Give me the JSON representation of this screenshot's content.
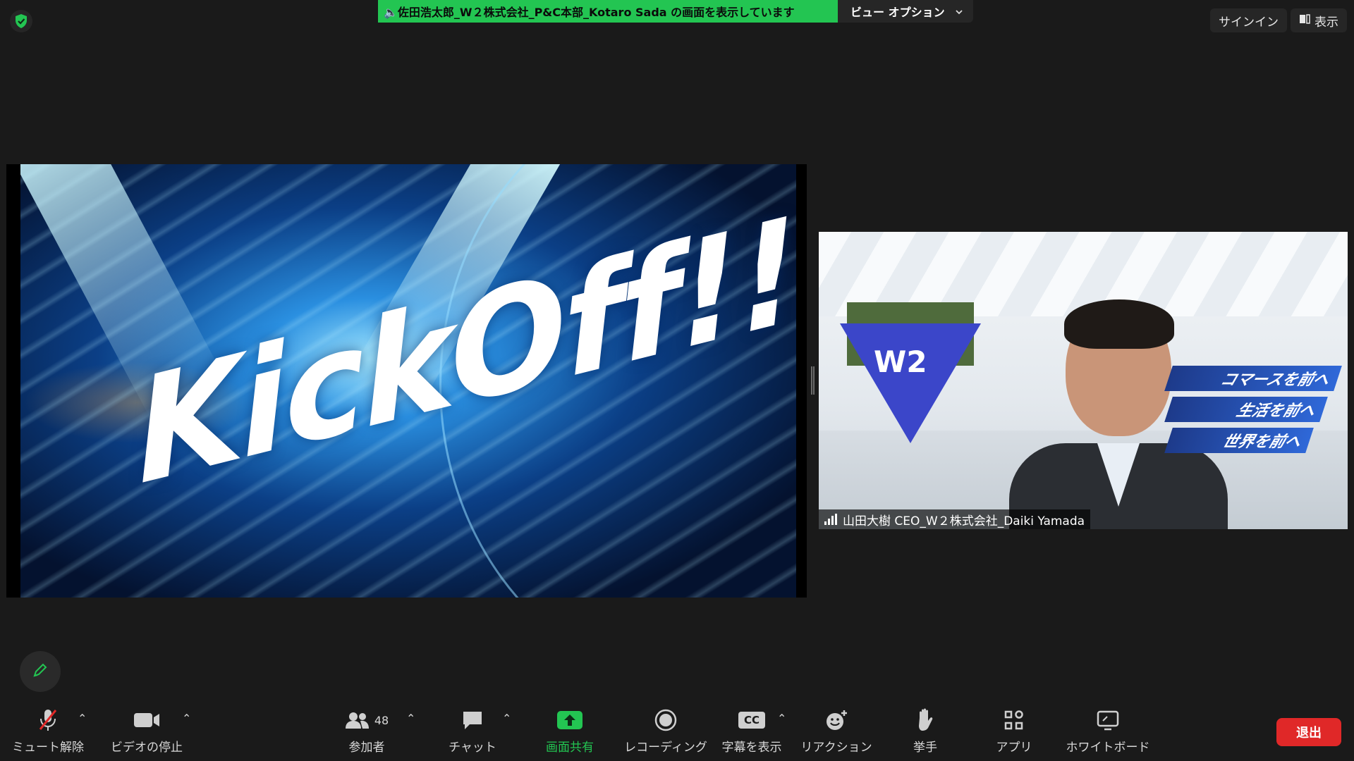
{
  "security": {
    "icon": "shield-check-icon",
    "color": "#23c552"
  },
  "share_banner": {
    "text": "🔈佐田浩太郎_W２株式会社_P&C本部_Kotaro Sada の画面を表示しています",
    "color": "#23c552"
  },
  "view_options": {
    "label": "ビュー オプション"
  },
  "top_right": {
    "signin": "サインイン",
    "display": "表示"
  },
  "shared_screen": {
    "title_text": "KickOff!!"
  },
  "video": {
    "logo": "W2",
    "slogans": [
      "コマースを前へ",
      "生活を前へ",
      "世界を前へ"
    ],
    "participant_name": "山田大樹 CEO_W２株式会社_Daiki Yamada"
  },
  "toolbar": {
    "mute": "ミュート解除",
    "video": "ビデオの停止",
    "participants": "参加者",
    "participants_count": "48",
    "chat": "チャット",
    "share": "画面共有",
    "record": "レコーディング",
    "captions": "字幕を表示",
    "captions_badge": "CC",
    "reactions": "リアクション",
    "raise_hand": "挙手",
    "apps": "アプリ",
    "whiteboard": "ホワイトボード",
    "leave": "退出"
  },
  "colors": {
    "accent_green": "#23c552",
    "leave_red": "#e02828",
    "background": "#1a1a1a"
  }
}
